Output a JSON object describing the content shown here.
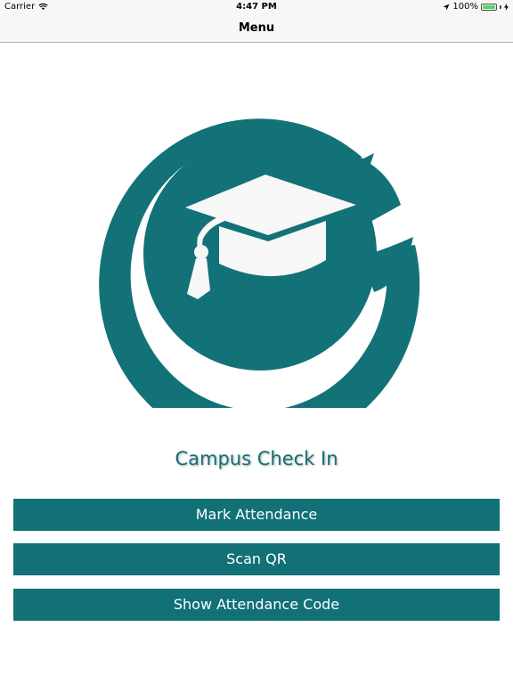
{
  "status_bar": {
    "carrier": "Carrier",
    "time": "4:47 PM",
    "battery_percent": "100%",
    "battery_level": 1.0,
    "icons": [
      "wifi-icon",
      "location-arrow-icon",
      "battery-icon",
      "charging-bolt-icon"
    ]
  },
  "nav": {
    "title": "Menu"
  },
  "app": {
    "title": "Campus Check In",
    "logo_icon": "graduation-cap-logo-icon"
  },
  "buttons": {
    "mark_attendance": "Mark Attendance",
    "scan_qr": "Scan QR",
    "show_attendance_code": "Show Attendance Code"
  },
  "colors": {
    "brand_teal": "#127077",
    "title_teal": "#137178",
    "bar_background": "#f7f7f7",
    "battery_green": "#4cd964"
  }
}
